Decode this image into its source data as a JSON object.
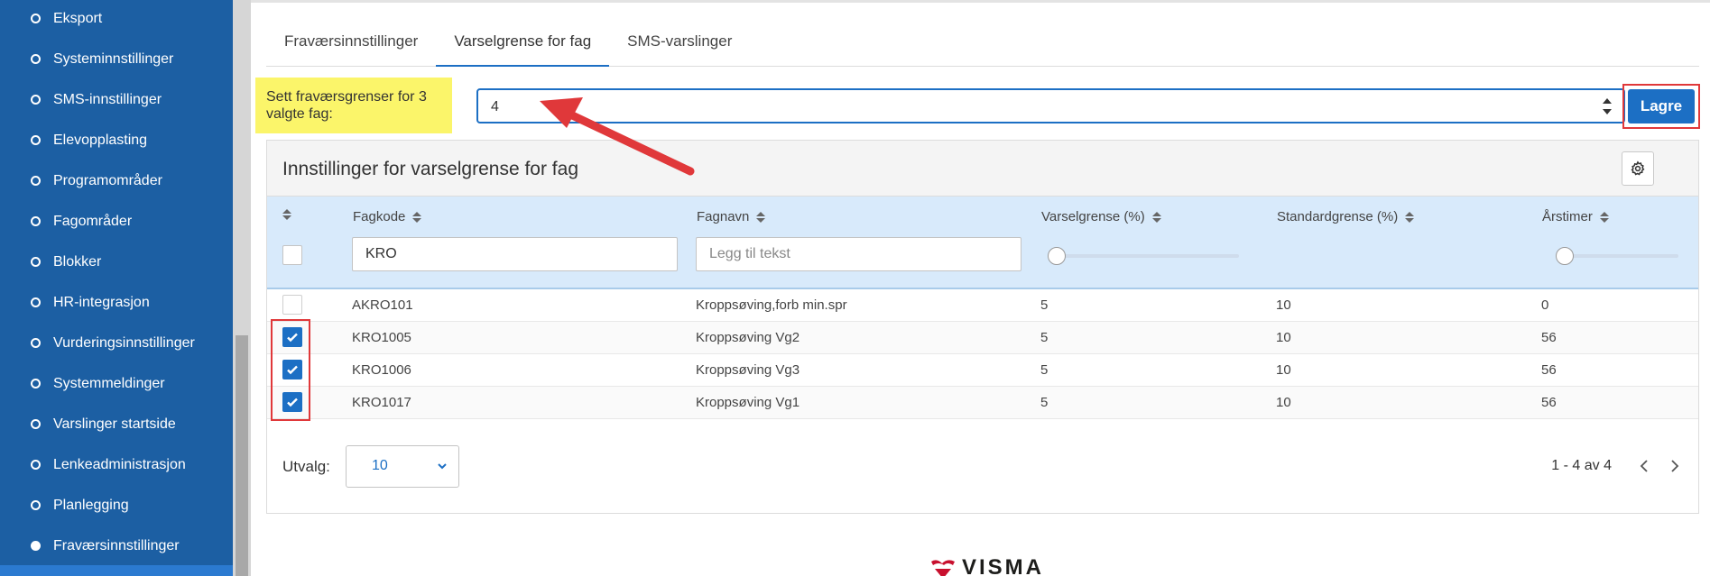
{
  "sidebar": {
    "items": [
      {
        "label": "Eksport",
        "active": false
      },
      {
        "label": "Systeminnstillinger",
        "active": false
      },
      {
        "label": "SMS-innstillinger",
        "active": false
      },
      {
        "label": "Elevopplasting",
        "active": false
      },
      {
        "label": "Programområder",
        "active": false
      },
      {
        "label": "Fagområder",
        "active": false
      },
      {
        "label": "Blokker",
        "active": false
      },
      {
        "label": "HR-integrasjon",
        "active": false
      },
      {
        "label": "Vurderingsinnstillinger",
        "active": false
      },
      {
        "label": "Systemmeldinger",
        "active": false
      },
      {
        "label": "Varslinger startside",
        "active": false
      },
      {
        "label": "Lenkeadministrasjon",
        "active": false
      },
      {
        "label": "Planlegging",
        "active": false
      },
      {
        "label": "Fraværsinnstillinger",
        "active": true
      }
    ]
  },
  "tabs": [
    {
      "label": "Fraværsinnstillinger",
      "active": false
    },
    {
      "label": "Varselgrense for fag",
      "active": true
    },
    {
      "label": "SMS-varslinger",
      "active": false
    }
  ],
  "limit_form": {
    "note": "Sett fraværsgrenser for 3 valgte fag:",
    "value": "4",
    "save_label": "Lagre"
  },
  "panel": {
    "title": "Innstillinger for varselgrense for fag",
    "columns": [
      "Fagkode",
      "Fagnavn",
      "Varselgrense (%)",
      "Standardgrense (%)",
      "Årstimer"
    ],
    "filters": {
      "fagkode_value": "KRO",
      "fagnavn_placeholder": "Legg til tekst"
    },
    "rows": [
      {
        "checked": false,
        "fagkode": "AKRO101",
        "fagnavn": "Kroppsøving,forb min.spr",
        "varselgrense": "5",
        "standardgrense": "10",
        "arstimer": "0"
      },
      {
        "checked": true,
        "fagkode": "KRO1005",
        "fagnavn": "Kroppsøving Vg2",
        "varselgrense": "5",
        "standardgrense": "10",
        "arstimer": "56"
      },
      {
        "checked": true,
        "fagkode": "KRO1006",
        "fagnavn": "Kroppsøving Vg3",
        "varselgrense": "5",
        "standardgrense": "10",
        "arstimer": "56"
      },
      {
        "checked": true,
        "fagkode": "KRO1017",
        "fagnavn": "Kroppsøving Vg1",
        "varselgrense": "5",
        "standardgrense": "10",
        "arstimer": "56"
      }
    ],
    "footer": {
      "utvalg_label": "Utvalg:",
      "utvalg_value": "10",
      "pager_text": "1 - 4 av 4"
    }
  },
  "logo_text": "VISMA",
  "colors": {
    "sidebar": "#1c5fa3",
    "accent": "#1c6fc4",
    "header_row": "#d8eafb",
    "highlight_note": "#fbf56a",
    "annotation_red": "#e0383a"
  }
}
